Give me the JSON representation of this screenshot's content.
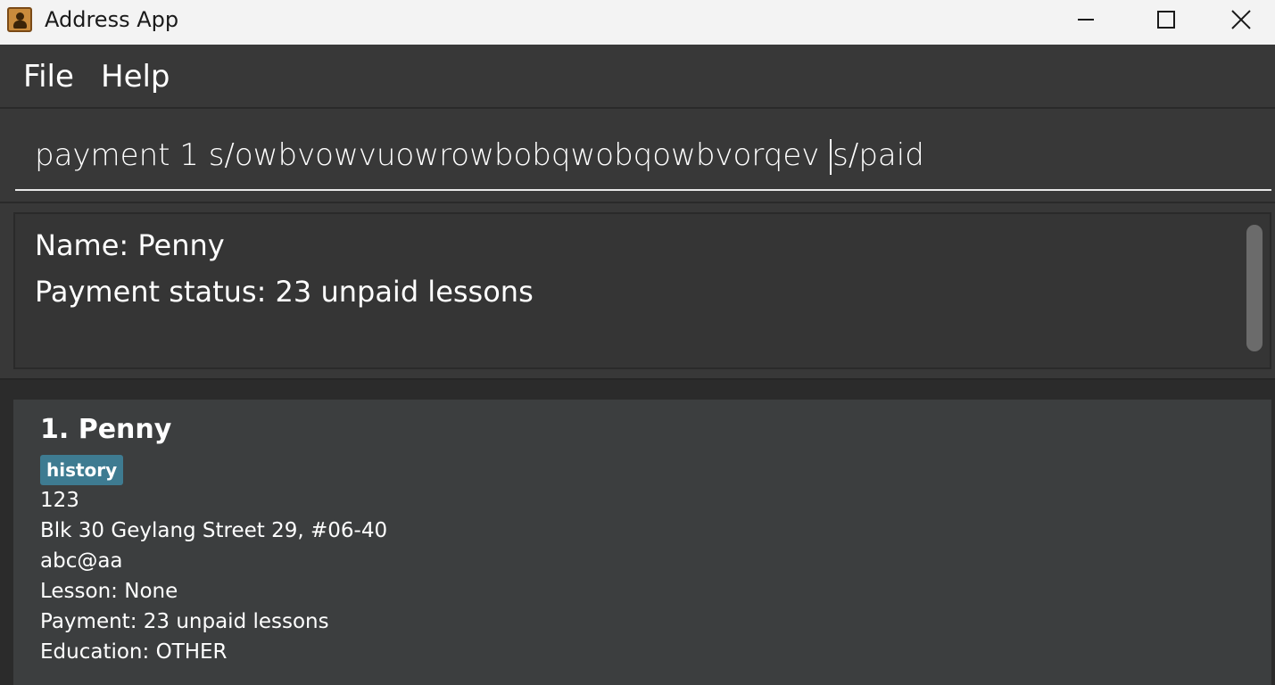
{
  "window": {
    "title": "Address App",
    "icon": "address-book-icon"
  },
  "menu": {
    "items": [
      {
        "label": "File"
      },
      {
        "label": "Help"
      }
    ]
  },
  "command_box": {
    "text_before_caret": "payment 1 s/owbvowvuowrowbobqwobqowbvorqev ",
    "text_after_caret": "s/paid"
  },
  "result_display": {
    "lines": [
      "Name: Penny",
      "Payment status: 23 unpaid lessons"
    ]
  },
  "person_list": [
    {
      "title": "1. Penny",
      "tags": [
        "history"
      ],
      "phone": "123",
      "address": "Blk 30 Geylang Street 29, #06-40",
      "email": "abc@aa",
      "lesson": "Lesson: None",
      "payment": "Payment: 23 unpaid lessons",
      "education": "Education: OTHER"
    }
  ],
  "colors": {
    "titlebar_bg": "#f3f3f3",
    "app_bg": "#383838",
    "card_bg": "#3c3e3f",
    "tag_bg": "#3e7b91",
    "text": "#ffffff"
  }
}
